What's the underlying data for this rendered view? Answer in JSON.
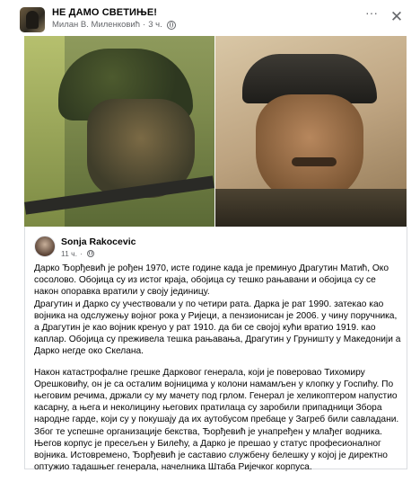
{
  "header": {
    "group_name": "НЕ ДАМО СВЕТИЊЕ!",
    "author": "Милан В. Миленковић",
    "separator": "·",
    "time": "3 ч.",
    "more_label": "···",
    "close_label": "✕"
  },
  "images": [
    {
      "name": "soldier-photo"
    },
    {
      "name": "portrait-painting"
    }
  ],
  "shared_post": {
    "author": "Sonja Rakocevic",
    "time": "11 ч.",
    "separator": "·",
    "paragraphs": [
      "Дарко Ђорђевић је рођен 1970, исте године када је преминуо Драгутин Матић, Око сосолово. Обојица су из истог краја, обојица су тешко рањавани и обојица су се након опоравка вратили у своју јединицу.\nДрагутин и Дарко су учествовали у по четири рата. Дарка је рат 1990. затекао као војника на одслужењу војног рока у Ријеци, а пензионисан је 2006. у чину поручника, а Драгутин је као војник кренуо у рат 1910. да би се својој кући вратио 1919. као каплар. Обојица су преживела тешка рањавања, Драгутин у Груништу у Македонији а Дарко негде око Скелана.",
      "Након катастрофалне грешке Дарковог генерала, који је поверовао Тихомиру Орешковићу, он је са осталим војницима у колони намамљен у клопку у Госпићу. По његовим речима, држали су му мачету под грлом. Генерал је хеликоптером напустио касарну, а њега и неколицину његових пратилаца су заробили припадници Збора народне гарде, који су у покушају да их аутобусом пребаце у Загреб били савладани. Због те успешне организације бекства, Ђорђевић је унапређен у млађег водника. Његов корпус је пресељен у Билећу, а Дарко је прешао у статус професионалног војника. Истовремено, Ђорђевић је саставио службену белешку у којој је директно оптужио тадашњег генерала, начелника Штаба Ријечког корпуса."
    ]
  }
}
